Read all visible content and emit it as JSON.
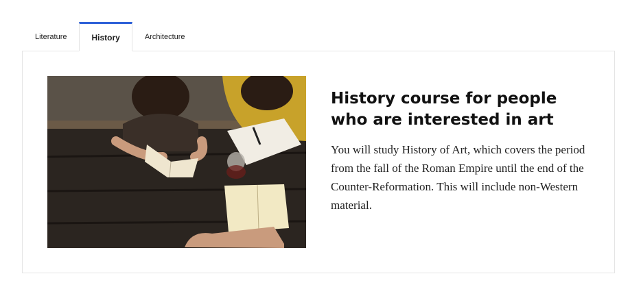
{
  "tabs": [
    {
      "label": "Literature",
      "active": false
    },
    {
      "label": "History",
      "active": true
    },
    {
      "label": "Architecture",
      "active": false
    }
  ],
  "panel": {
    "image_alt": "Students reading books at a wooden table",
    "title": "History course for people who are interested in art",
    "body": "You will study History of Art, which covers the period from the fall of the Roman Empire until the end of the Counter-Reformation. This will include non-Western material."
  },
  "colors": {
    "accent": "#2f62d8",
    "border": "#e4e4e4"
  }
}
